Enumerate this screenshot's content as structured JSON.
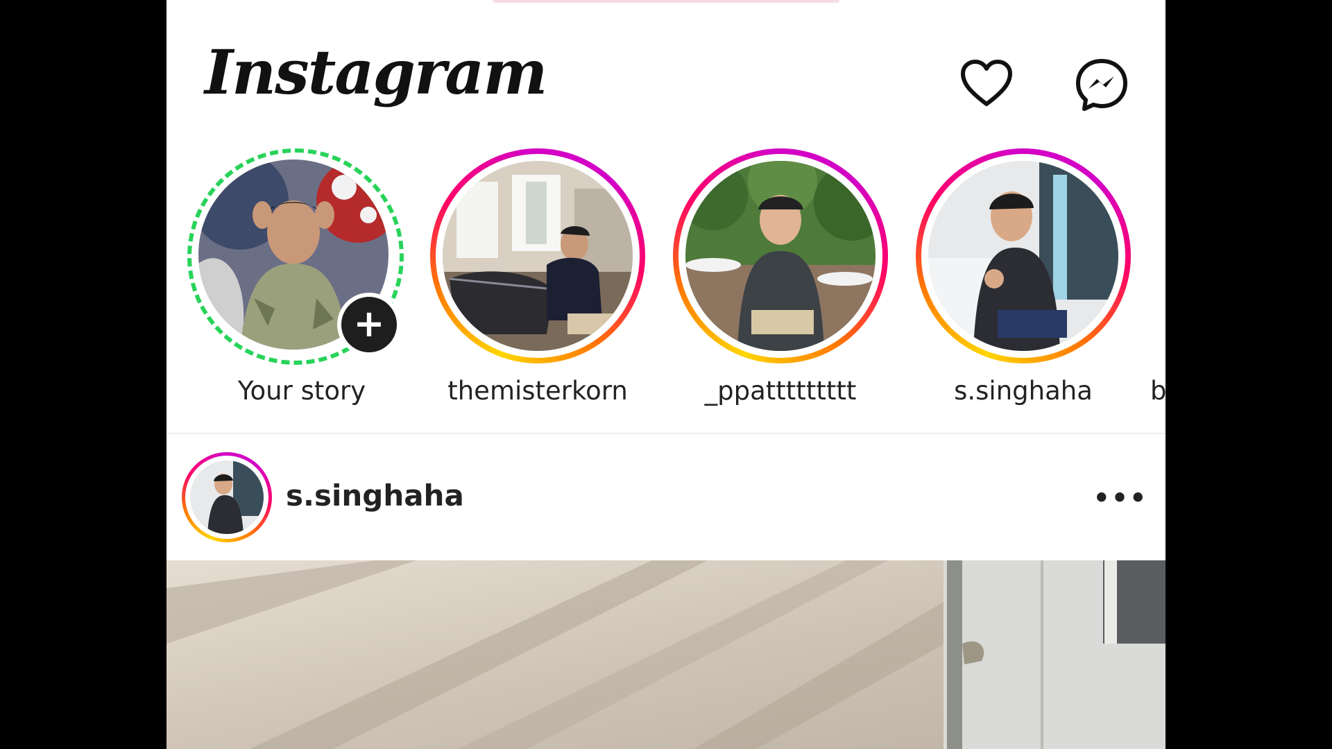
{
  "app": {
    "logo_text": "Instagram"
  },
  "header": {
    "notifications_icon": "heart-icon",
    "messages_icon": "messenger-icon"
  },
  "stories": {
    "items": [
      {
        "label": "Your story",
        "own": true,
        "badge": "+"
      },
      {
        "label": "themisterkorn",
        "own": false
      },
      {
        "label": "_ppattttttttt",
        "own": false
      },
      {
        "label": "s.singhaha",
        "own": false
      }
    ],
    "partial_label": "b"
  },
  "post": {
    "username": "s.singhaha",
    "more_label": "•••"
  },
  "colors": {
    "story_ring_gradient": [
      "#ffd600",
      "#ff7a00",
      "#ff0069",
      "#d300c5"
    ],
    "own_story_ring": "#28d35a",
    "background": "#ffffff",
    "text": "#222222"
  }
}
